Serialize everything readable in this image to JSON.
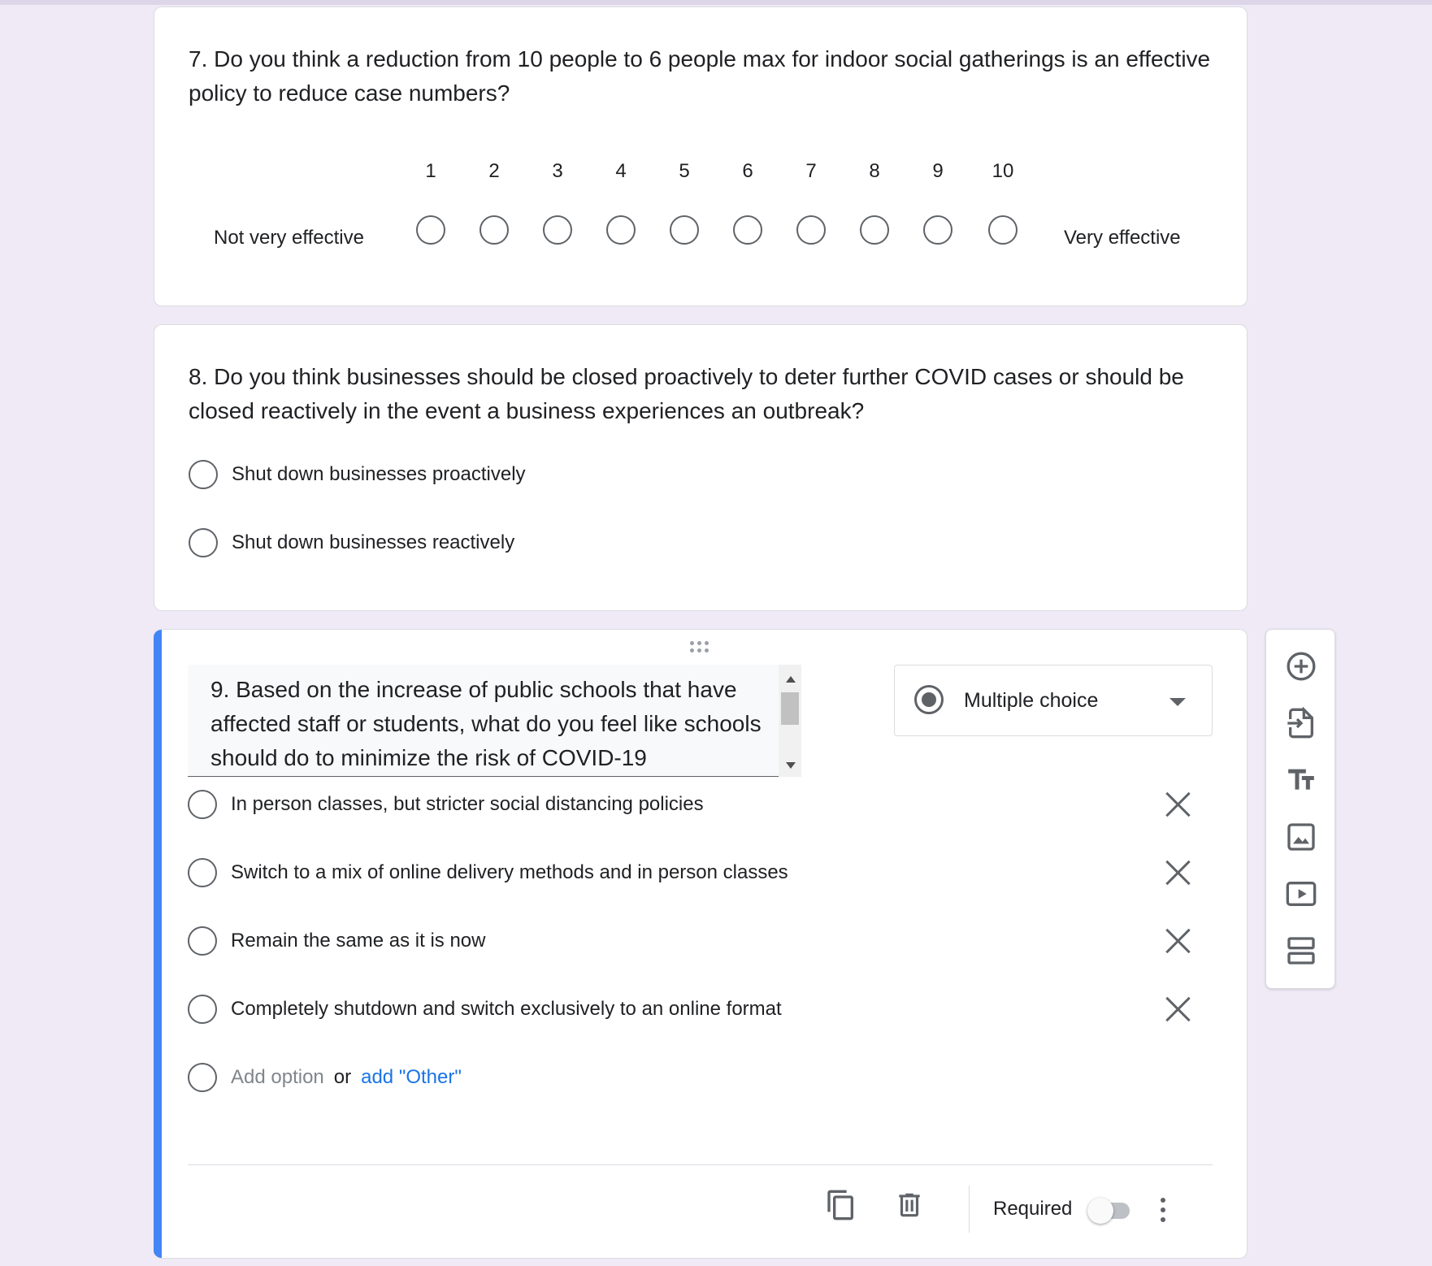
{
  "q7": {
    "title": "7. Do you think a reduction from 10 people to 6 people max for indoor social gatherings is an effective policy to reduce case numbers?",
    "scale": [
      "1",
      "2",
      "3",
      "4",
      "5",
      "6",
      "7",
      "8",
      "9",
      "10"
    ],
    "low_label": "Not very effective",
    "high_label": "Very effective"
  },
  "q8": {
    "title": "8. Do you think businesses should be closed proactively to deter further COVID cases or should be closed reactively in the event a business experiences an outbreak?",
    "options": [
      "Shut down businesses proactively",
      "Shut down businesses reactively"
    ]
  },
  "q9": {
    "title": "9. Based on the increase of public schools that have affected staff or students, what do you feel like schools should do to minimize the risk of COVID-19",
    "type": "Multiple choice",
    "options": [
      "In person classes, but stricter social distancing policies",
      "Switch to a mix of online delivery methods and in person classes",
      "Remain the same as it is now",
      "Completely shutdown and switch exclusively to an online format"
    ],
    "add_option": "Add option",
    "or": "or",
    "add_other": "add \"Other\"",
    "required_label": "Required",
    "required": false
  },
  "icons": {
    "toolbar": [
      "add-question-icon",
      "import-questions-icon",
      "add-title-icon",
      "add-image-icon",
      "add-video-icon",
      "add-section-icon"
    ],
    "footer": [
      "duplicate-icon",
      "delete-icon",
      "more-options-icon"
    ]
  },
  "colors": {
    "accent": "#4285f4",
    "link": "#1a73e8",
    "background": "#efeaf6"
  }
}
